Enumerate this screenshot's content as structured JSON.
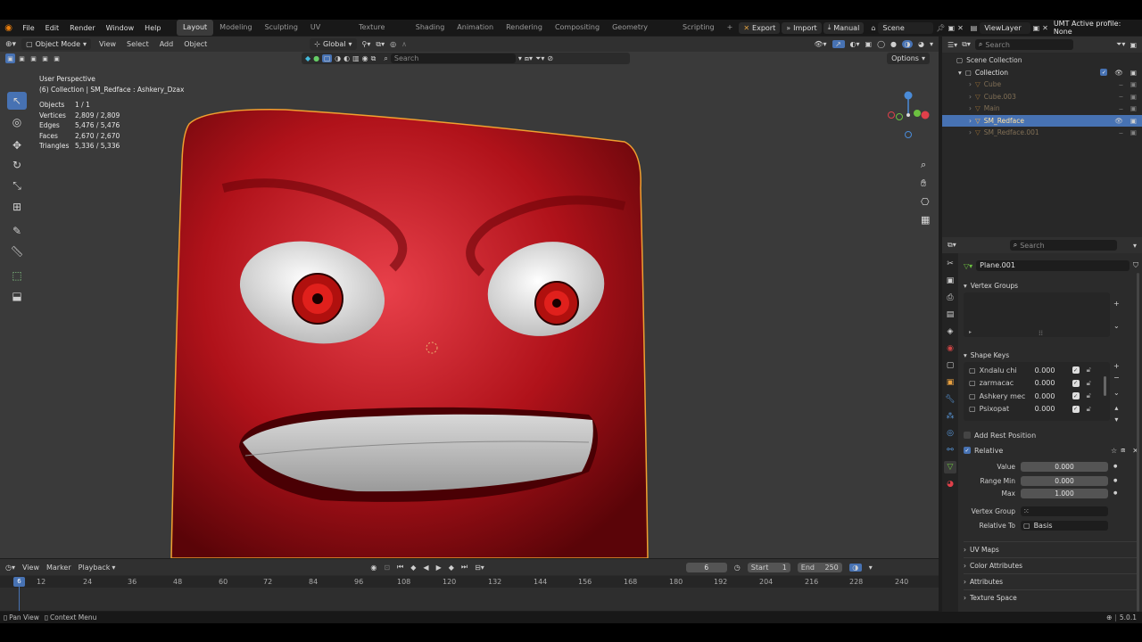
{
  "topbar": {
    "menus": [
      "File",
      "Edit",
      "Render",
      "Window",
      "Help"
    ],
    "workspaces": [
      "Layout",
      "Modeling",
      "Sculpting",
      "UV Editing",
      "Texture Paint",
      "Shading",
      "Animation",
      "Rendering",
      "Compositing",
      "Geometry Nodes",
      "Scripting"
    ],
    "active_workspace": "Layout",
    "plus": "+",
    "export_label": "Export",
    "import_label": "Import",
    "manual_label": "Manual",
    "scene_label": "Scene",
    "viewlayer_label": "ViewLayer",
    "umt_label": "UMT Active profile: None"
  },
  "viewport": {
    "mode": "Object Mode",
    "menus": [
      "View",
      "Select",
      "Add",
      "Object"
    ],
    "orientation": "Global",
    "search_placeholder": "Search",
    "options_label": "Options",
    "perspective": "User Perspective",
    "collection_path": "(6) Collection | SM_Redface : Ashkery_Dzax",
    "stats": [
      {
        "label": "Objects",
        "value": "1 / 1"
      },
      {
        "label": "Vertices",
        "value": "2,809 / 2,809"
      },
      {
        "label": "Edges",
        "value": "5,476 / 5,476"
      },
      {
        "label": "Faces",
        "value": "2,670 / 2,670"
      },
      {
        "label": "Triangles",
        "value": "5,336 / 5,336"
      }
    ]
  },
  "outliner": {
    "search_placeholder": "Search",
    "scene_collection": "Scene Collection",
    "collection": "Collection",
    "items": [
      {
        "name": "Cube",
        "selected": false
      },
      {
        "name": "Cube.003",
        "selected": false
      },
      {
        "name": "Main",
        "selected": false
      },
      {
        "name": "SM_Redface",
        "selected": true
      },
      {
        "name": "SM_Redface.001",
        "selected": false
      }
    ]
  },
  "properties": {
    "search_placeholder": "Search",
    "mesh_name": "Plane.001",
    "vertex_groups_label": "Vertex Groups",
    "shape_keys_label": "Shape Keys",
    "shape_keys": [
      {
        "name": "Xndalu chi",
        "value": "0.000"
      },
      {
        "name": "zarmacac",
        "value": "0.000"
      },
      {
        "name": "Ashkery mec",
        "value": "0.000"
      },
      {
        "name": "Psixopat",
        "value": "0.000"
      }
    ],
    "add_rest_position": "Add Rest Position",
    "relative_label": "Relative",
    "value_label": "Value",
    "value": "0.000",
    "range_min_label": "Range Min",
    "range_min": "0.000",
    "max_label": "Max",
    "max": "1.000",
    "vertex_group_label": "Vertex Group",
    "relative_to_label": "Relative To",
    "relative_to": "Basis",
    "sections": [
      "UV Maps",
      "Color Attributes",
      "Attributes",
      "Texture Space"
    ]
  },
  "timeline": {
    "menus": [
      "View",
      "Marker",
      "Playback"
    ],
    "current_frame": "6",
    "start_label": "Start",
    "start": "1",
    "end_label": "End",
    "end": "250",
    "ruler": [
      "12",
      "24",
      "36",
      "48",
      "60",
      "72",
      "84",
      "96",
      "108",
      "120",
      "132",
      "144",
      "156",
      "168",
      "180",
      "192",
      "204",
      "216",
      "228",
      "240"
    ],
    "playhead": "6"
  },
  "status": {
    "pan_view": "Pan View",
    "context_menu": "Context Menu",
    "version": "5.0.1"
  },
  "colors": {
    "accent": "#4772b3",
    "selection_outline": "#f0a030",
    "face_red": "#c4161c"
  }
}
